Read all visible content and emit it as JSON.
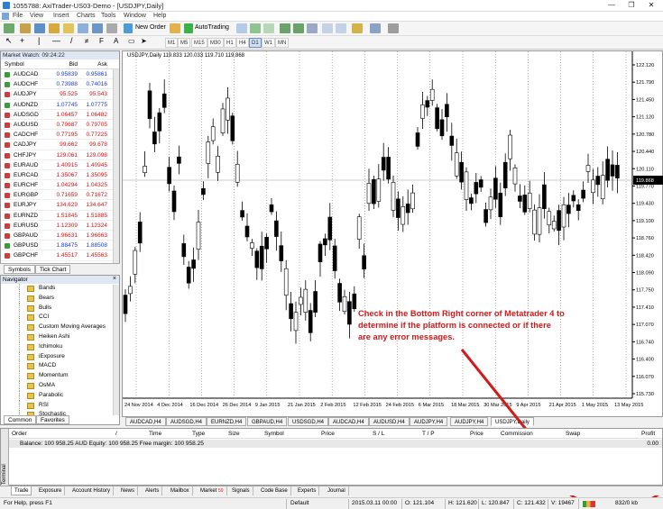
{
  "window": {
    "title": "1055788: AxiTrader-US03-Demo - [USDJPY,Daily]",
    "min": "—",
    "max": "❐",
    "close": "✕"
  },
  "menu": [
    "File",
    "View",
    "Insert",
    "Charts",
    "Tools",
    "Window",
    "Help"
  ],
  "toolbar": {
    "new_order": "New Order",
    "auto_trading": "AutoTrading",
    "timeframes": [
      "M1",
      "M5",
      "M15",
      "M30",
      "H1",
      "H4",
      "D1",
      "W1",
      "MN"
    ],
    "active_timeframe": "D1"
  },
  "market_watch": {
    "title": "Market Watch: 09:24:22",
    "col_symbol": "Symbol",
    "col_bid": "Bid",
    "col_ask": "Ask",
    "rows": [
      {
        "symbol": "AUDCAD",
        "bid": "0.95839",
        "ask": "0.95861",
        "dir": "up"
      },
      {
        "symbol": "AUDCHF",
        "bid": "0.73988",
        "ask": "0.74016",
        "dir": "up"
      },
      {
        "symbol": "AUDJPY",
        "bid": "95.525",
        "ask": "95.543",
        "dir": "dn"
      },
      {
        "symbol": "AUDNZD",
        "bid": "1.07745",
        "ask": "1.07775",
        "dir": "up"
      },
      {
        "symbol": "AUDSGD",
        "bid": "1.06457",
        "ask": "1.06482",
        "dir": "dn"
      },
      {
        "symbol": "AUDUSD",
        "bid": "0.79687",
        "ask": "0.79705",
        "dir": "dn"
      },
      {
        "symbol": "CADCHF",
        "bid": "0.77195",
        "ask": "0.77225",
        "dir": "dn"
      },
      {
        "symbol": "CADJPY",
        "bid": "99.662",
        "ask": "99.678",
        "dir": "dn"
      },
      {
        "symbol": "CHFJPY",
        "bid": "129.061",
        "ask": "129.098",
        "dir": "dn"
      },
      {
        "symbol": "EURAUD",
        "bid": "1.40915",
        "ask": "1.40945",
        "dir": "dn"
      },
      {
        "symbol": "EURCAD",
        "bid": "1.35067",
        "ask": "1.35095",
        "dir": "dn"
      },
      {
        "symbol": "EURCHF",
        "bid": "1.04294",
        "ask": "1.04325",
        "dir": "dn"
      },
      {
        "symbol": "EURGBP",
        "bid": "0.71659",
        "ask": "0.71672",
        "dir": "dn"
      },
      {
        "symbol": "EURJPY",
        "bid": "134.629",
        "ask": "134.647",
        "dir": "dn"
      },
      {
        "symbol": "EURNZD",
        "bid": "1.51845",
        "ask": "1.51885",
        "dir": "dn"
      },
      {
        "symbol": "EURUSD",
        "bid": "1.12309",
        "ask": "1.12324",
        "dir": "dn"
      },
      {
        "symbol": "GBPAUD",
        "bid": "1.96631",
        "ask": "1.96663",
        "dir": "dn"
      },
      {
        "symbol": "GBPUSD",
        "bid": "1.88475",
        "ask": "1.88508",
        "dir": "up"
      },
      {
        "symbol": "GBPCHF",
        "bid": "1.45517",
        "ask": "1.45563",
        "dir": "dn"
      }
    ],
    "tabs": [
      "Symbols",
      "Tick Chart"
    ]
  },
  "navigator": {
    "title": "Navigator",
    "items": [
      "Bands",
      "Bears",
      "Bulls",
      "CCI",
      "Custom Moving Averages",
      "Heiken Ashi",
      "Ichimoku",
      "iExposure",
      "MACD",
      "Momentum",
      "OsMA",
      "Parabolic",
      "RSI",
      "Stochastic"
    ],
    "tabs": [
      "Common",
      "Favorites"
    ]
  },
  "chart": {
    "label": "USDJPY,Daily  119.833 120.033 119.710 119.868",
    "current_price": "119.868",
    "price_labels": [
      "122.120",
      "121.790",
      "121.450",
      "121.120",
      "120.780",
      "120.440",
      "120.110",
      "119.770",
      "119.430",
      "119.100",
      "118.760",
      "118.420",
      "118.090",
      "117.750",
      "117.410",
      "117.070",
      "116.740",
      "116.400",
      "116.070",
      "115.730"
    ],
    "date_labels": [
      "24 Nov 2014",
      "4 Dec 2014",
      "16 Dec 2014",
      "26 Dec 2014",
      "9 Jan 2015",
      "21 Jan 2015",
      "2 Feb 2015",
      "12 Feb 2015",
      "24 Feb 2015",
      "6 Mar 2015",
      "18 Mar 2015",
      "30 Mar 2015",
      "9 Apr 2015",
      "21 Apr 2015",
      "1 May 2015",
      "13 May 2015"
    ],
    "tabs": [
      "AUDCAD,H4",
      "AUDSGD,H4",
      "EURNZD,H4",
      "GBPAUD,H4",
      "USDSGD,H4",
      "AUDCAD,H4",
      "AUDUSD,H4",
      "AUDJPY,H4",
      "AUDJPY,H4",
      "USDJPY,Daily"
    ],
    "active_tab": "USDJPY,Daily"
  },
  "annotation": "Check in the Bottom Right corner of Metatrader 4 to determine if the platform is connected or if there are any error messages.",
  "terminal": {
    "side_label": "Terminal",
    "columns": [
      "Order",
      "/",
      "Time",
      "Type",
      "Size",
      "Symbol",
      "Price",
      "S / L",
      "T / P",
      "Price",
      "Commission",
      "Swap",
      "Profit"
    ],
    "balance": "Balance: 100 958.25 AUD  Equity: 100 958.25  Free margin: 100 958.25",
    "profit": "0.00",
    "tabs": [
      "Trade",
      "Exposure",
      "Account History",
      "News",
      "Alerts",
      "Mailbox",
      "Market",
      "Signals",
      "Code Base",
      "Experts",
      "Journal"
    ],
    "market_badge": "59"
  },
  "status": {
    "help": "For Help, press F1",
    "profile": "Default",
    "datetime": "2015.03.11 00:00",
    "open": "O: 121.104",
    "high": "H: 121.620",
    "low": "L: 120.847",
    "close": "C: 121.432",
    "volume": "V: 19467",
    "traffic": "832/0 kb"
  },
  "colors": {
    "annotation": "#d31919",
    "candle": "#000000",
    "bid_up": "#1a3bd3",
    "bid_down": "#d11111"
  }
}
